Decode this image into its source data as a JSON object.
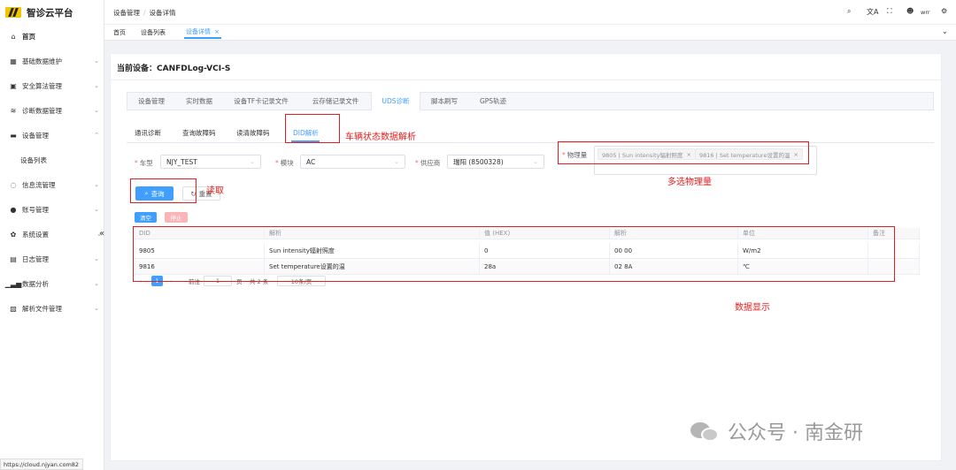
{
  "app": {
    "title": "智诊云平台",
    "logo_text": "N"
  },
  "sidebar": {
    "items": [
      {
        "label": "首页",
        "icon": "home-icon",
        "arrow": ""
      },
      {
        "label": "基础数据维护",
        "icon": "grid-icon",
        "arrow": "⌄"
      },
      {
        "label": "安全算法管理",
        "icon": "lock-icon",
        "arrow": "⌄"
      },
      {
        "label": "诊断数据管理",
        "icon": "database-icon",
        "arrow": "⌄"
      },
      {
        "label": "设备管理",
        "icon": "monitor-icon",
        "arrow": "⌃"
      },
      {
        "label": "设备列表",
        "icon": "",
        "arrow": ""
      },
      {
        "label": "信息流管理",
        "icon": "chat-icon",
        "arrow": "⌄"
      },
      {
        "label": "账号管理",
        "icon": "user-icon",
        "arrow": "⌄"
      },
      {
        "label": "系统设置",
        "icon": "gear-icon",
        "arrow": "⌄"
      },
      {
        "label": "日志管理",
        "icon": "log-icon",
        "arrow": "⌄"
      },
      {
        "label": "数据分析",
        "icon": "bar-chart-icon",
        "arrow": "⌄"
      },
      {
        "label": "解析文件管理",
        "icon": "file-icon",
        "arrow": "⌄"
      }
    ],
    "collapse": "«",
    "status_url": "https://cloud.njyan.com82"
  },
  "header": {
    "breadcrumb": [
      "设备管理",
      "设备详情"
    ],
    "user": "wrr",
    "tags": [
      {
        "label": "首页"
      },
      {
        "label": "设备列表"
      },
      {
        "label": "设备详情",
        "close": "×"
      }
    ]
  },
  "device": {
    "label": "当前设备：",
    "name": "CANFDLog-VCI-S"
  },
  "tabs": [
    "设备管理",
    "实时数据",
    "设备TF卡记录文件",
    "云存储记录文件",
    "UDS诊断",
    "脚本刷写",
    "GPS轨迹"
  ],
  "subtabs": [
    "通讯诊断",
    "查询故障码",
    "读清故障码",
    "DID解析"
  ],
  "form": {
    "vehicle": {
      "label": "车型",
      "value": "NJY_TEST"
    },
    "module": {
      "label": "模块",
      "value": "AC"
    },
    "supplier": {
      "label": "供应商",
      "value": "瑞阳 (8500328)"
    },
    "physical": {
      "label": "物理量",
      "chips": [
        "9805 | Sun intensity辐射照度",
        "9816 | Set temperature设置的温"
      ]
    },
    "query_button": "查询",
    "reset_button": "重置",
    "clear_button": "清空",
    "stop_button": "停止"
  },
  "table": {
    "headers": [
      "DID",
      "解析",
      "值 (HEX)",
      "解析",
      "单位",
      "备注"
    ],
    "rows": [
      [
        "9805",
        "Sun intensity辐射照度",
        "0",
        "00 00",
        "W/m2",
        ""
      ],
      [
        "9816",
        "Set temperature设置的温",
        "28a",
        "02 8A",
        "℃",
        ""
      ]
    ]
  },
  "pager": {
    "prefix": "前往",
    "page": "1",
    "suffix": "页",
    "total": "共 2 条",
    "size": "10条/页"
  },
  "annotations": {
    "did": "车辆状态数据解析",
    "read": "读取",
    "multi": "多选物理量",
    "display": "数据显示"
  },
  "watermark": "公众号 · 南金研"
}
